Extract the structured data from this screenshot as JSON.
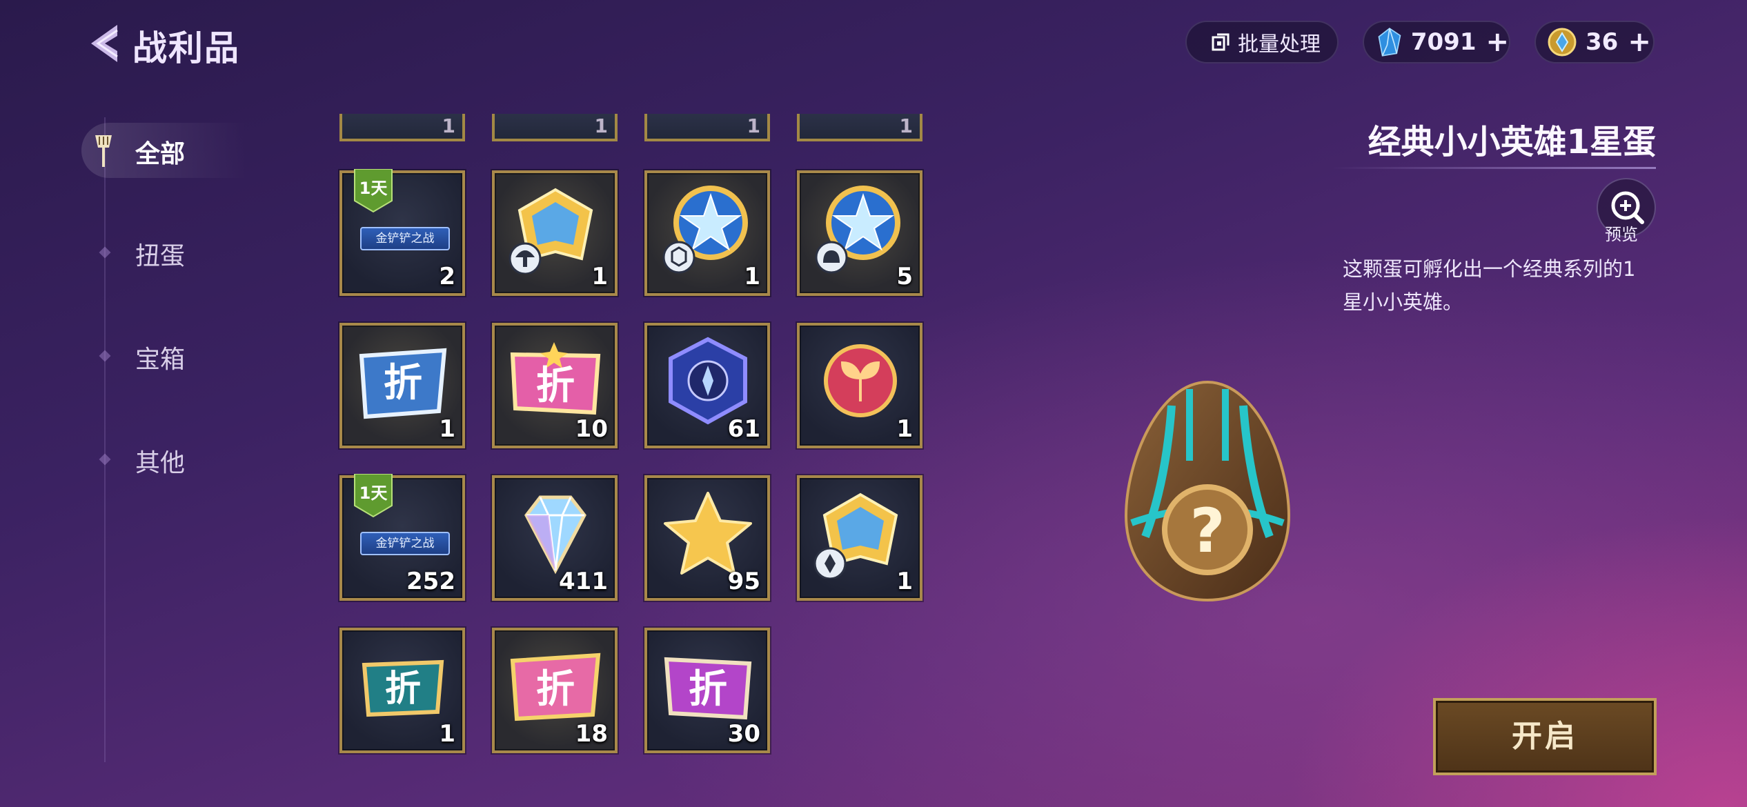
{
  "header": {
    "title": "战利品",
    "batch_label": "批量处理",
    "gems": "7091",
    "coins": "36"
  },
  "sidebar": {
    "items": [
      {
        "label": "全部",
        "active": true
      },
      {
        "label": "扭蛋"
      },
      {
        "label": "宝箱"
      },
      {
        "label": "其他"
      }
    ]
  },
  "grid": {
    "partial_row": [
      "1",
      "1",
      "1",
      "1"
    ],
    "rows": [
      [
        {
          "qty": "2",
          "art": "ticket-icon",
          "badge": "1天",
          "banner": "金铲铲之战"
        },
        {
          "qty": "1",
          "art": "gold-shield-mushroom-icon"
        },
        {
          "qty": "1",
          "art": "star-medal-dice-icon"
        },
        {
          "qty": "5",
          "art": "star-medal-bell-icon"
        }
      ],
      [
        {
          "qty": "1",
          "art": "discount-coupon-blue-icon",
          "label": "折"
        },
        {
          "qty": "10",
          "art": "discount-coupon-pink-icon",
          "label": "折"
        },
        {
          "qty": "61",
          "art": "hex-shard-icon"
        },
        {
          "qty": "1",
          "art": "leaf-orb-icon"
        }
      ],
      [
        {
          "qty": "252",
          "art": "ticket-icon",
          "badge": "1天",
          "banner": "金铲铲之战"
        },
        {
          "qty": "411",
          "art": "diamond-gem-icon"
        },
        {
          "qty": "95",
          "art": "gold-star-icon"
        },
        {
          "qty": "1",
          "art": "gold-shield-pin-icon"
        }
      ],
      [
        {
          "qty": "1",
          "art": "discount-coupon-teal-icon",
          "label": "折"
        },
        {
          "qty": "18",
          "art": "discount-coupon-gold-icon",
          "label": "折"
        },
        {
          "qty": "30",
          "art": "discount-coupon-purple-icon",
          "label": "折"
        }
      ]
    ]
  },
  "detail": {
    "title": "经典小小英雄1星蛋",
    "preview_label": "预览",
    "description": "这颗蛋可孵化出一个经典系列的1星小小英雄。",
    "open_label": "开启"
  }
}
